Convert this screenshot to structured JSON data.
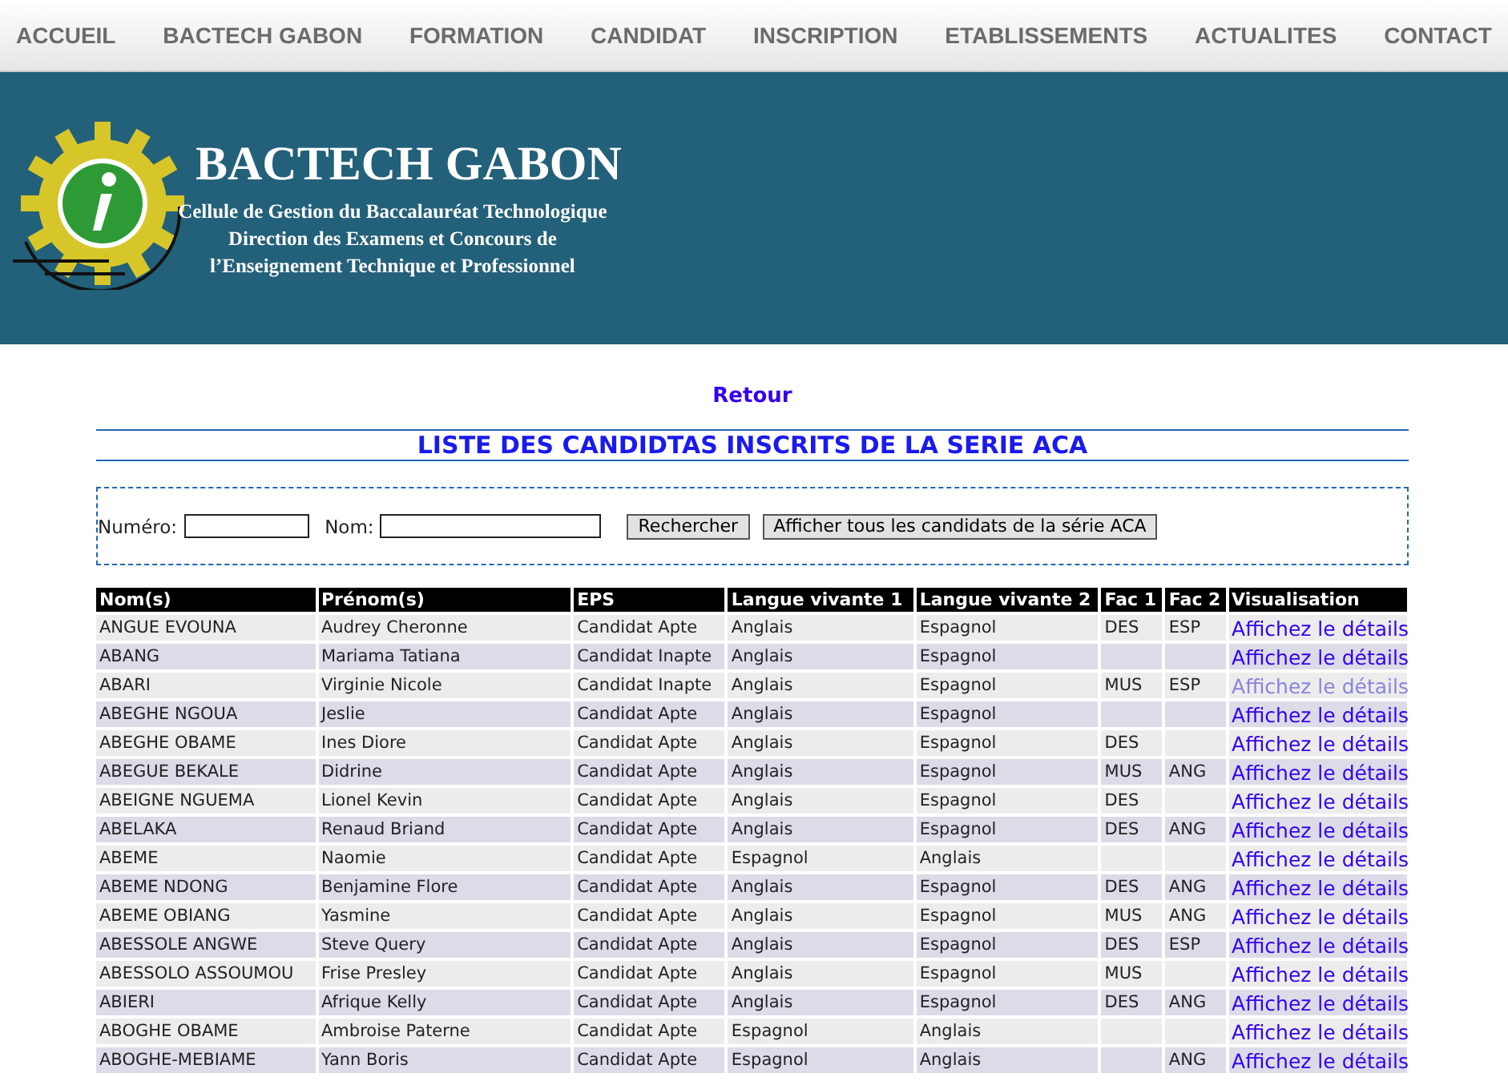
{
  "nav": {
    "items": [
      {
        "label": "ACCUEIL"
      },
      {
        "label": "BACTECH GABON"
      },
      {
        "label": "FORMATION"
      },
      {
        "label": "CANDIDAT"
      },
      {
        "label": "INSCRIPTION"
      },
      {
        "label": "ETABLISSEMENTS"
      },
      {
        "label": "ACTUALITES"
      },
      {
        "label": "CONTACT"
      }
    ]
  },
  "banner": {
    "title": "BACTECH GABON",
    "subtitle_lines": [
      "Cellule de Gestion du Baccalauréat Technologique",
      "Direction des Examens et Concours de",
      "l’Enseignement Technique et Professionnel"
    ]
  },
  "back_link": "Retour",
  "heading": "LISTE DES CANDIDTAS INSCRITS DE LA SERIE ACA",
  "search": {
    "fields": [
      {
        "label": "Numéro:"
      },
      {
        "label": "Nom:"
      }
    ],
    "buttons": [
      "Rechercher",
      "Afficher tous les candidats de la série ACA"
    ]
  },
  "table": {
    "columns": [
      "Nom(s)",
      "Prénom(s)",
      "EPS",
      "Langue vivante 1",
      "Langue vivante 2",
      "Fac 1",
      "Fac 2",
      "Visualisation"
    ],
    "rows": [
      {
        "cells": [
          "ANGUE EVOUNA",
          "Audrey Cheronne",
          "Candidat Apte",
          "Anglais",
          "Espagnol",
          "DES",
          "ESP"
        ],
        "link": "Affichez le détails",
        "visited": false
      },
      {
        "cells": [
          "ABANG",
          "Mariama Tatiana",
          "Candidat Inapte",
          "Anglais",
          "Espagnol",
          "",
          ""
        ],
        "link": "Affichez le détails",
        "visited": false
      },
      {
        "cells": [
          "ABARI",
          "Virginie Nicole",
          "Candidat Inapte",
          "Anglais",
          "Espagnol",
          "MUS",
          "ESP"
        ],
        "link": "Affichez le détails",
        "visited": true
      },
      {
        "cells": [
          "ABEGHE NGOUA",
          "Jeslie",
          "Candidat Apte",
          "Anglais",
          "Espagnol",
          "",
          ""
        ],
        "link": "Affichez le détails",
        "visited": false
      },
      {
        "cells": [
          "ABEGHE OBAME",
          "Ines Diore",
          "Candidat Apte",
          "Anglais",
          "Espagnol",
          "DES",
          ""
        ],
        "link": "Affichez le détails",
        "visited": false
      },
      {
        "cells": [
          "ABEGUE BEKALE",
          "Didrine",
          "Candidat Apte",
          "Anglais",
          "Espagnol",
          "MUS",
          "ANG"
        ],
        "link": "Affichez le détails",
        "visited": false
      },
      {
        "cells": [
          "ABEIGNE NGUEMA",
          "Lionel Kevin",
          "Candidat Apte",
          "Anglais",
          "Espagnol",
          "DES",
          ""
        ],
        "link": "Affichez le détails",
        "visited": false
      },
      {
        "cells": [
          "ABELAKA",
          "Renaud Briand",
          "Candidat Apte",
          "Anglais",
          "Espagnol",
          "DES",
          "ANG"
        ],
        "link": "Affichez le détails",
        "visited": false
      },
      {
        "cells": [
          "ABEME",
          "Naomie",
          "Candidat Apte",
          "Espagnol",
          "Anglais",
          "",
          ""
        ],
        "link": "Affichez le détails",
        "visited": false
      },
      {
        "cells": [
          "ABEME NDONG",
          "Benjamine Flore",
          "Candidat Apte",
          "Anglais",
          "Espagnol",
          "DES",
          "ANG"
        ],
        "link": "Affichez le détails",
        "visited": false
      },
      {
        "cells": [
          "ABEME OBIANG",
          "Yasmine",
          "Candidat Apte",
          "Anglais",
          "Espagnol",
          "MUS",
          "ANG"
        ],
        "link": "Affichez le détails",
        "visited": false
      },
      {
        "cells": [
          "ABESSOLE ANGWE",
          "Steve Query",
          "Candidat Apte",
          "Anglais",
          "Espagnol",
          "DES",
          "ESP"
        ],
        "link": "Affichez le détails",
        "visited": false
      },
      {
        "cells": [
          "ABESSOLO ASSOUMOU",
          "Frise Presley",
          "Candidat Apte",
          "Anglais",
          "Espagnol",
          "MUS",
          ""
        ],
        "link": "Affichez le détails",
        "visited": false
      },
      {
        "cells": [
          "ABIERI",
          "Afrique Kelly",
          "Candidat Apte",
          "Anglais",
          "Espagnol",
          "DES",
          "ANG"
        ],
        "link": "Affichez le détails",
        "visited": false
      },
      {
        "cells": [
          "ABOGHE OBAME",
          "Ambroise Paterne",
          "Candidat Apte",
          "Espagnol",
          "Anglais",
          "",
          ""
        ],
        "link": "Affichez le détails",
        "visited": false
      },
      {
        "cells": [
          "ABOGHE-MEBIAME",
          "Yann Boris",
          "Candidat Apte",
          "Espagnol",
          "Anglais",
          "",
          "ANG"
        ],
        "link": "Affichez le détails",
        "visited": false
      }
    ]
  }
}
